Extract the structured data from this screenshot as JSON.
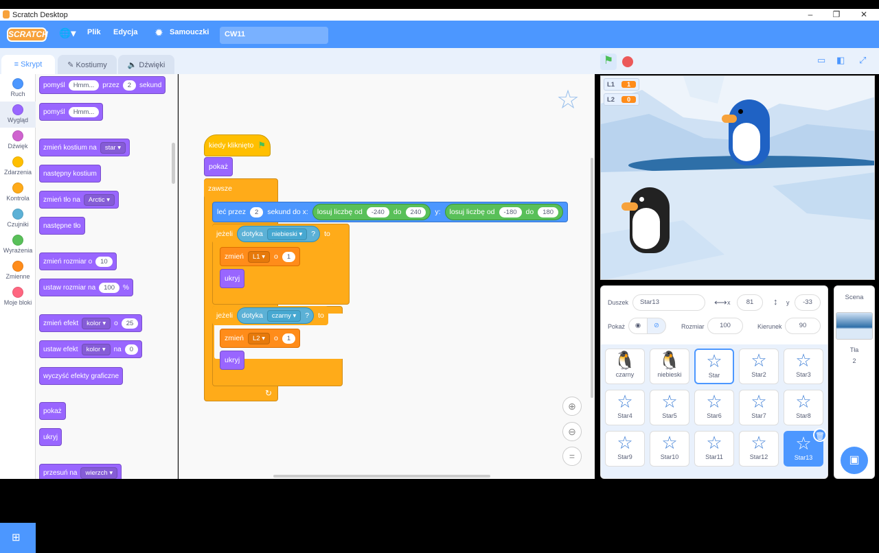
{
  "window": {
    "title": "Scratch Desktop",
    "controls": [
      "–",
      "❐",
      "✕"
    ]
  },
  "menu": {
    "logo": "SCRATCH",
    "file": "Plik",
    "edit": "Edycja",
    "tutorials": "Samouczki",
    "project_name": "CW11"
  },
  "tabs": {
    "code": "Skrypt",
    "costumes": "Kostiumy",
    "sounds": "Dźwięki"
  },
  "categories": [
    {
      "label": "Ruch",
      "color": "#4c97ff"
    },
    {
      "label": "Wygląd",
      "color": "#9966ff"
    },
    {
      "label": "Dźwięk",
      "color": "#cf63cf"
    },
    {
      "label": "Zdarzenia",
      "color": "#ffbf00"
    },
    {
      "label": "Kontrola",
      "color": "#ffab19"
    },
    {
      "label": "Czujniki",
      "color": "#5cb1d6"
    },
    {
      "label": "Wyrażenia",
      "color": "#59c059"
    },
    {
      "label": "Zmienne",
      "color": "#ff8c1a"
    },
    {
      "label": "Moje bloki",
      "color": "#ff6680"
    }
  ],
  "palette": {
    "think_for": {
      "a": "pomyśl",
      "msg": "Hmm...",
      "b": "przez",
      "secs": "2",
      "c": "sekund"
    },
    "think": {
      "a": "pomyśl",
      "msg": "Hmm..."
    },
    "switch_costume": {
      "a": "zmień kostium na",
      "val": "star"
    },
    "next_costume": "następny kostium",
    "switch_backdrop": {
      "a": "zmień tło na",
      "val": "Arctic"
    },
    "next_backdrop": "następne tło",
    "change_size": {
      "a": "zmień rozmiar o",
      "val": "10"
    },
    "set_size": {
      "a": "ustaw rozmiar na",
      "val": "100",
      "b": "%"
    },
    "change_effect": {
      "a": "zmień efekt",
      "effect": "kolor",
      "b": "o",
      "val": "25"
    },
    "set_effect": {
      "a": "ustaw efekt",
      "effect": "kolor",
      "b": "na",
      "val": "0"
    },
    "clear_effects": "wyczyść efekty graficzne",
    "show": "pokaż",
    "hide": "ukryj",
    "go_to_layer": {
      "a": "przesuń na",
      "val": "wierzch"
    }
  },
  "script": {
    "hat": "kiedy kliknięto",
    "show": "pokaż",
    "forever": "zawsze",
    "glide": {
      "a": "leć przez",
      "secs": "2",
      "b": "sekund do x:",
      "rand": "losuj liczbę od",
      "x_from": "-240",
      "to": "do",
      "x_to": "240",
      "y": "y:",
      "y_from": "-180",
      "y_to": "180"
    },
    "if1": {
      "a": "jeżeli",
      "touch": "dotyka",
      "target": "niebieski",
      "q": "?",
      "then": "to"
    },
    "change1": {
      "a": "zmień",
      "var": "L1",
      "b": "o",
      "val": "1"
    },
    "hide1": "ukryj",
    "if2": {
      "a": "jeżeli",
      "touch": "dotyka",
      "target": "czarny",
      "q": "?",
      "then": "to"
    },
    "change2": {
      "a": "zmień",
      "var": "L2",
      "b": "o",
      "val": "1"
    },
    "hide2": "ukryj"
  },
  "monitors": [
    {
      "name": "L1",
      "value": "1"
    },
    {
      "name": "L2",
      "value": "0"
    }
  ],
  "sprite_info": {
    "sprite_label": "Duszek",
    "sprite_name": "Star13",
    "x_label": "x",
    "x": "81",
    "y_label": "y",
    "y": "-33",
    "show_label": "Pokaż",
    "size_label": "Rozmiar",
    "size": "100",
    "direction_label": "Kierunek",
    "direction": "90"
  },
  "sprites": [
    "czarny",
    "niebieski",
    "Star",
    "Star2",
    "Star3",
    "Star4",
    "Star5",
    "Star6",
    "Star7",
    "Star8",
    "Star9",
    "Star10",
    "Star11",
    "Star12",
    "Star13"
  ],
  "scene": {
    "title": "Scena",
    "backdrops_label": "Tła",
    "backdrops_count": "2"
  }
}
